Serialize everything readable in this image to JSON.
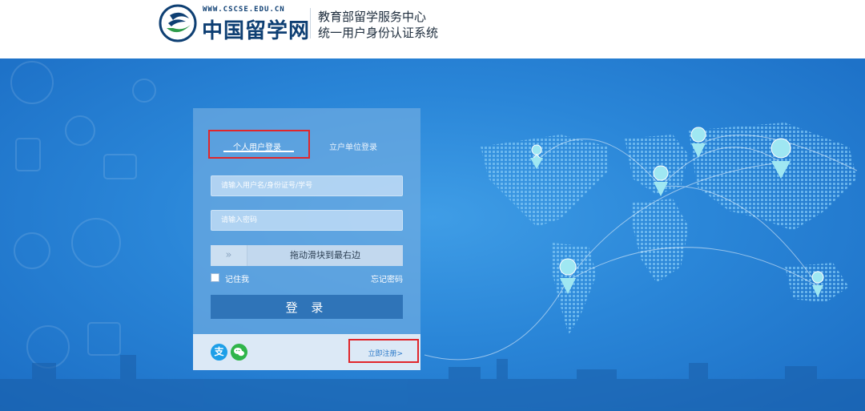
{
  "header": {
    "logo_url_text": "WWW.CSCSE.EDU.CN",
    "logo_text": "中国留学网",
    "org_name": "教育部留学服务中心",
    "system_name": "统一用户身份认证系统"
  },
  "login": {
    "tabs": [
      {
        "label": "个人用户登录",
        "active": true
      },
      {
        "label": "立户单位登录",
        "active": false
      }
    ],
    "username_placeholder": "请输入用户名/身份证号/学号",
    "password_placeholder": "请输入密码",
    "slider_text": "拖动滑块到最右边",
    "slider_handle_glyph": "»",
    "remember_label": "记住我",
    "forgot_label": "忘记密码",
    "login_button": "登 录",
    "register_link": "立即注册>",
    "alipay_glyph": "支"
  },
  "icons": [
    "alipay-icon",
    "wechat-icon",
    "map-pin-icon",
    "slider-arrows-icon"
  ],
  "colors": {
    "brand_dark": "#0e3f73",
    "background_blue": "#2a86d8",
    "button_blue": "#2f74b8",
    "highlight_red": "#e0262b",
    "alipay_blue": "#1d9fe8",
    "wechat_green": "#2fb54a"
  }
}
